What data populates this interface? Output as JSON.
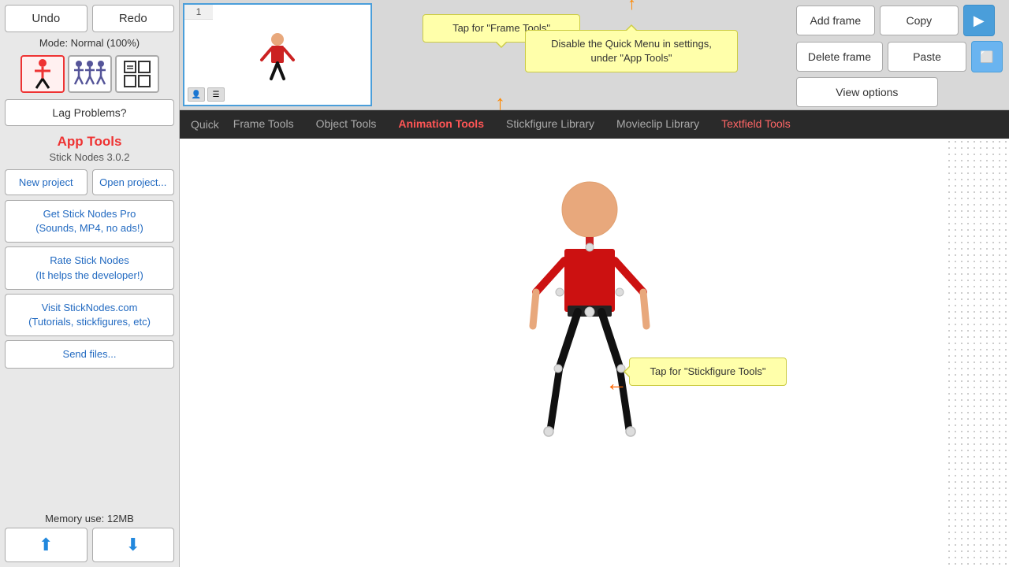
{
  "sidebar": {
    "undo_label": "Undo",
    "redo_label": "Redo",
    "mode_label": "Mode: Normal (100%)",
    "lag_btn_label": "Lag Problems?",
    "app_tools_title": "App Tools",
    "version": "Stick Nodes 3.0.2",
    "new_project_label": "New project",
    "open_project_label": "Open project...",
    "get_pro_label": "Get Stick Nodes Pro\n(Sounds, MP4, no ads!)",
    "rate_label": "Rate Stick Nodes\n(It helps the developer!)",
    "visit_label": "Visit StickNodes.com\n(Tutorials, stickfigures, etc)",
    "send_files_label": "Send files...",
    "memory_label": "Memory use: 12MB",
    "arrow_up_label": "↑",
    "arrow_down_label": "↓"
  },
  "topbar": {
    "frame_number": "1",
    "add_frame_label": "Add frame",
    "copy_label": "Copy",
    "delete_frame_label": "Delete frame",
    "paste_label": "Paste",
    "view_options_label": "View options",
    "play_icon": "▶"
  },
  "nav": {
    "quick_label": "Quick",
    "tabs": [
      {
        "label": "Frame Tools",
        "active": false,
        "highlight": false
      },
      {
        "label": "Object Tools",
        "active": false,
        "highlight": false
      },
      {
        "label": "Animation Tools",
        "active": false,
        "highlight": true
      },
      {
        "label": "Stickfigure Library",
        "active": false,
        "highlight": false
      },
      {
        "label": "Movieclip Library",
        "active": false,
        "highlight": false
      },
      {
        "label": "Textfield Tools",
        "active": false,
        "highlight": false
      }
    ]
  },
  "tooltips": {
    "frame_tools": "Tap for \"Frame Tools\"",
    "quick_menu": "Disable the Quick Menu in settings,\nunder \"App Tools\"",
    "stickfigure_tools": "Tap for \"Stickfigure Tools\""
  },
  "icons": {
    "person_red": "🔴",
    "persons_blue": "👥",
    "grid": "⊞",
    "up_arrow": "⬆",
    "down_arrow": "⬇"
  }
}
